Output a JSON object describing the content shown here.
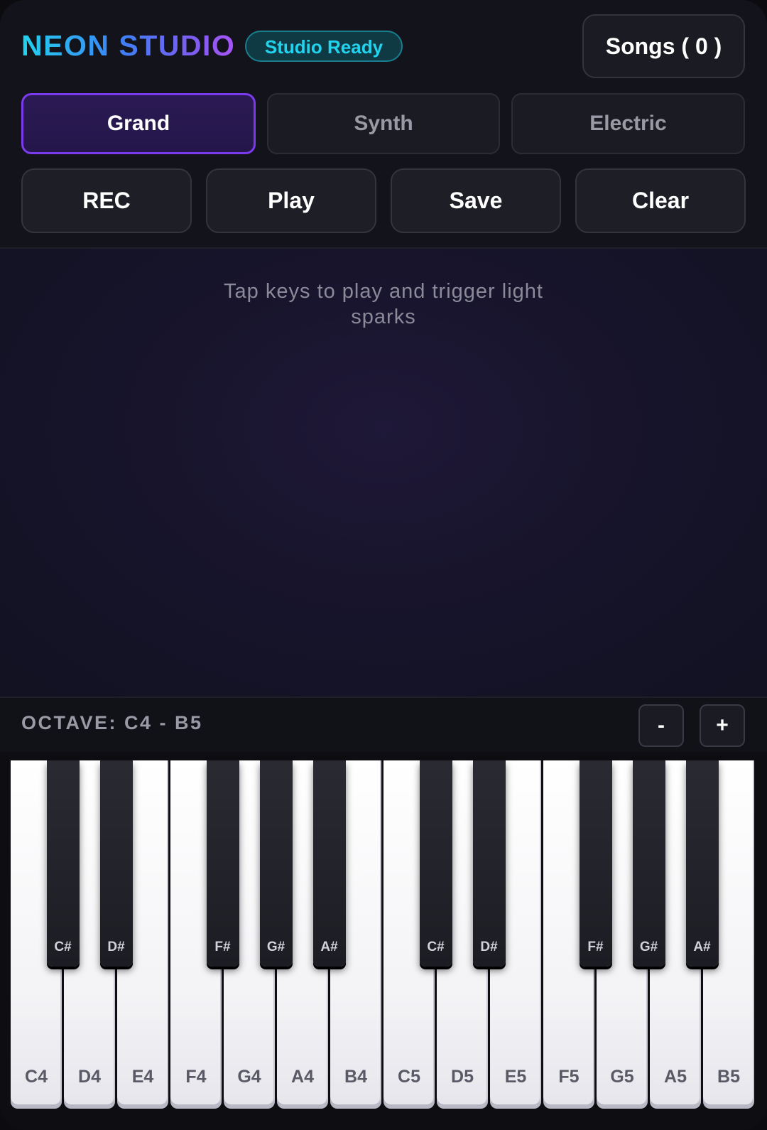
{
  "header": {
    "brand": "NEON STUDIO",
    "status": "Studio Ready",
    "songs_label": "Songs ( 0 )"
  },
  "modes": [
    {
      "label": "Grand",
      "active": true
    },
    {
      "label": "Synth",
      "active": false
    },
    {
      "label": "Electric",
      "active": false
    }
  ],
  "actions": {
    "rec": "REC",
    "play": "Play",
    "save": "Save",
    "clear": "Clear"
  },
  "visual": {
    "hint": "Tap keys to play and trigger light sparks"
  },
  "octave": {
    "label": "OCTAVE: C4 - B5",
    "minus": "-",
    "plus": "+"
  },
  "keys": {
    "white": [
      "C4",
      "D4",
      "E4",
      "F4",
      "G4",
      "A4",
      "B4",
      "C5",
      "D5",
      "E5",
      "F5",
      "G5",
      "A5",
      "B5"
    ],
    "black": [
      "C#",
      "D#",
      "F#",
      "G#",
      "A#",
      "C#",
      "D#",
      "F#",
      "G#",
      "A#"
    ]
  },
  "colors": {
    "accent": "#7c3aed",
    "status": "#22d3ee"
  }
}
